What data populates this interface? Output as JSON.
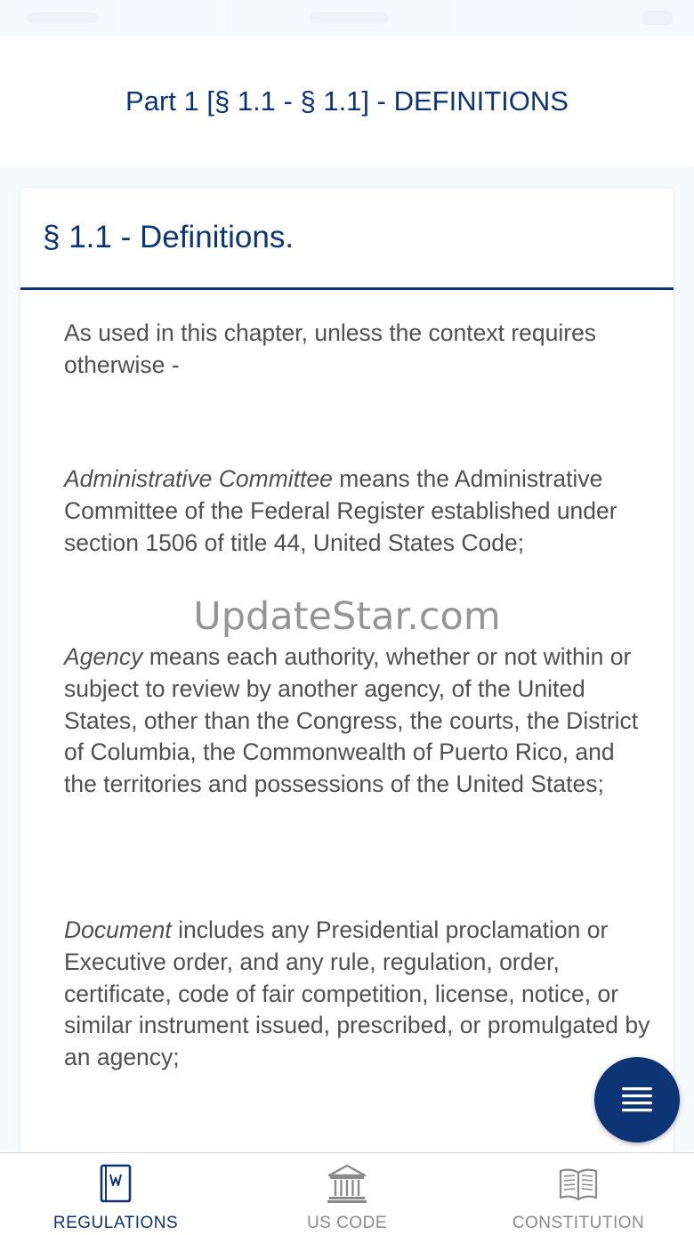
{
  "header": {
    "title": "Part 1 [§ 1.1 - § 1.1] - DEFINITIONS"
  },
  "section": {
    "title": "§ 1.1 - Definitions.",
    "intro": "As used in this chapter, unless the context requires otherwise -",
    "definitions": [
      {
        "term": "Administrative Committee",
        "text": " means the Administrative Committee of the Federal Register established under section 1506 of title 44, United States Code;"
      },
      {
        "term": "Agency",
        "text": " means each authority, whether or not within or subject to review by another agency, of the United States, other than the Congress, the courts, the District of Columbia, the Commonwealth of Puerto Rico, and the territories and possessions of the United States;"
      },
      {
        "term": "Document",
        "text": " includes any Presidential proclamation or Executive order, and any rule, regulation, order, certificate, code of fair competition, license, notice, or similar instrument issued, prescribed, or promulgated by an agency;"
      }
    ]
  },
  "watermark": "UpdateStar.com",
  "fab": {
    "icon": "menu-icon"
  },
  "tabs": [
    {
      "label": "REGULATIONS",
      "icon": "book-icon",
      "active": true
    },
    {
      "label": "US CODE",
      "icon": "courthouse-icon",
      "active": false
    },
    {
      "label": "CONSTITUTION",
      "icon": "open-book-icon",
      "active": false
    }
  ],
  "colors": {
    "primary": "#0d3475",
    "inactive": "#8a8a8a",
    "body_text": "#505050"
  }
}
